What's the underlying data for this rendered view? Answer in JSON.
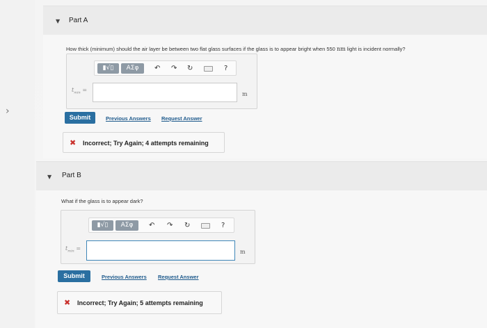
{
  "side_nav": {
    "chevron_glyph": "›"
  },
  "part_a": {
    "title": "Part A",
    "question": "How thick (minimum) should the air layer be between two flat glass surfaces if the glass is to appear bright when 550",
    "question_unit": "nm",
    "question_tail": "light is incident normally?",
    "toolbar": {
      "sqrt_label": "▮√▯",
      "greek_label": "ΑΣφ",
      "undo_glyph": "↶",
      "redo_glyph": "↷",
      "reset_glyph": "↻",
      "help_label": "?"
    },
    "variable": "t",
    "variable_sub": "min",
    "equals": "=",
    "input_value": "",
    "unit": "m",
    "submit_label": "Submit",
    "previous_answers_label": "Previous Answers",
    "request_answer_label": "Request Answer",
    "feedback_icon": "✖",
    "feedback_text": "Incorrect; Try Again; 4 attempts remaining"
  },
  "part_b": {
    "title": "Part B",
    "question": "What if the glass is to appear dark?",
    "toolbar": {
      "sqrt_label": "▮√▯",
      "greek_label": "ΑΣφ",
      "undo_glyph": "↶",
      "redo_glyph": "↷",
      "reset_glyph": "↻",
      "help_label": "?"
    },
    "variable": "t",
    "variable_sub": "min",
    "equals": "=",
    "input_value": "",
    "unit": "m",
    "submit_label": "Submit",
    "previous_answers_label": "Previous Answers",
    "request_answer_label": "Request Answer",
    "feedback_icon": "✖",
    "feedback_text": "Incorrect; Try Again; 5 attempts remaining"
  },
  "colors": {
    "submit_bg": "#2a6fa1",
    "link": "#1e5a8c",
    "error_x": "#c9302c",
    "focus_border": "#3f86b8"
  }
}
